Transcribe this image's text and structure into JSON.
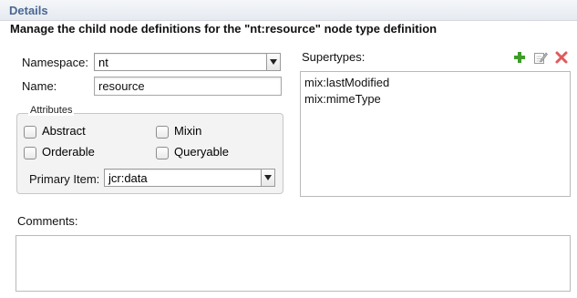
{
  "section": {
    "title": "Details",
    "description": "Manage the child node definitions for the \"nt:resource\" node type definition"
  },
  "form": {
    "namespace_label": "Namespace:",
    "namespace_value": "nt",
    "name_label": "Name:",
    "name_value": "resource",
    "attributes_title": "Attributes",
    "checkboxes": {
      "abstract": {
        "label": "Abstract",
        "checked": false
      },
      "mixin": {
        "label": "Mixin",
        "checked": false
      },
      "orderable": {
        "label": "Orderable",
        "checked": false
      },
      "queryable": {
        "label": "Queryable",
        "checked": false
      }
    },
    "primary_item_label": "Primary Item:",
    "primary_item_value": "jcr:data",
    "comments_label": "Comments:",
    "comments_value": ""
  },
  "supertypes": {
    "label": "Supertypes:",
    "items": [
      "mix:lastModified",
      "mix:mimeType"
    ],
    "toolbar_icons": [
      "add-icon",
      "edit-icon",
      "delete-icon"
    ]
  },
  "colors": {
    "section_title": "#4a6792",
    "add_icon": "#3f9c2a",
    "delete_icon": "#e05a5a"
  }
}
